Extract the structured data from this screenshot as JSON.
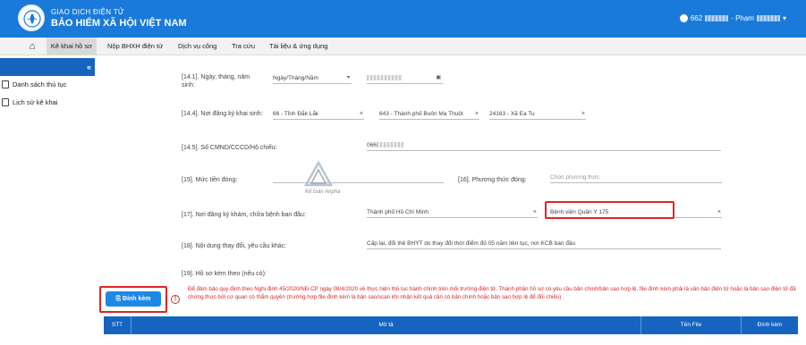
{
  "header": {
    "brand_line1": "GIAO DỊCH ĐIỆN TỬ",
    "brand_line2": "BẢO HIỂM XÃ HỘI VIỆT NAM",
    "user_prefix": "662",
    "user_mid": "- Phạm",
    "user_caret": "▾"
  },
  "nav": {
    "home_icon": "⌂",
    "items": [
      "Kê khai hồ sơ",
      "Nộp BHXH điện tử",
      "Dịch vụ công",
      "Tra cứu",
      "Tài liệu & ứng dụng"
    ]
  },
  "sidebar": {
    "collapse_icon": "«",
    "items": [
      "Danh sách thủ tục",
      "Lịch sử kê khai"
    ]
  },
  "form": {
    "dob": {
      "label": "[14.1]. Ngày, tháng, năm sinh:",
      "format": "Ngày/Tháng/Năm",
      "value_prefix": ""
    },
    "reg_place": {
      "label": "[14.4]. Nơi đăng ký khai sinh:",
      "province": "66 - Tỉnh Đắk Lắk",
      "district": "643 - Thành phố Buôn Ma Thuột",
      "ward": "24163 - Xã Ea Tu"
    },
    "id_no": {
      "label": "[14.5]. Số CMND/CCCD/Hộ chiếu:",
      "value_prefix": "066"
    },
    "wage_level": {
      "label": "[15]. Mức tiền đóng:",
      "value": ""
    },
    "payment_method": {
      "label": "[16]. Phương thức đóng:",
      "placeholder": "Chọn phương thức"
    },
    "hospital": {
      "label": "[17]. Nơi đăng ký khám, chữa bệnh ban đầu:",
      "city": "Thành phố Hồ Chí Minh",
      "name": "Bệnh viện Quân Y 175"
    },
    "change_content": {
      "label": "[18]. Nội dung thay đổi, yêu cầu khác:",
      "value": "Cấp lại, đổi thẻ BHYT do thay đổi thời điểm đủ 05 năm liên tục, nơi KCB ban đầu"
    },
    "attachments_label": "[19]. Hồ sơ kèm theo (nếu có):"
  },
  "attach": {
    "button_label": "Đính kèm",
    "warn_icon": "!",
    "note": "Để đảm bảo quy định theo Nghị định 45/2020/NĐ-CP ngày 08/4/2020 về thực hiện thủ tục hành chính trên môi trường điện tử. Thành phần hồ sơ có yêu cầu bản chính/bản sao hợp lệ, file đính kèm phải là văn bản điện tử hoặc là bản sao điện tử đã chứng thực bởi cơ quan có thẩm quyền (trường hợp file đính kèm là bản sao/scan khi nhận kết quả cần có bản chính hoặc bản sao hợp lệ để đối chiếu)"
  },
  "table": {
    "headers": [
      "STT",
      "Mô tả",
      "Tên File",
      "Đính kèm"
    ]
  },
  "watermark": {
    "text": "Kế toán Anpha"
  },
  "colors": {
    "brand": "#1a7ad9",
    "sidebar_head": "#1565c0",
    "highlight": "#e02424",
    "attach_button": "#1e88e5"
  }
}
